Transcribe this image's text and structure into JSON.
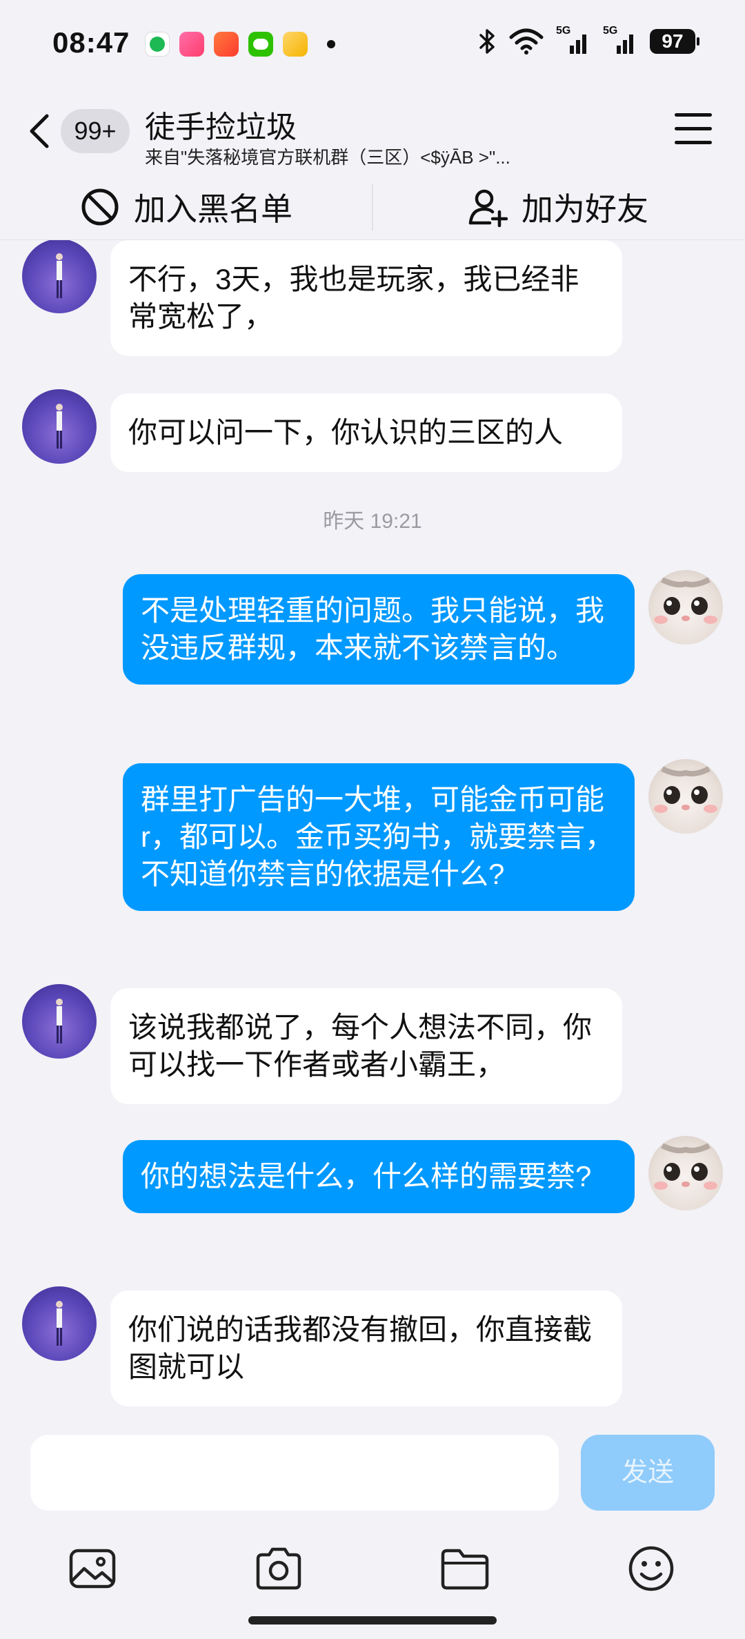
{
  "status_bar": {
    "time": "08:47",
    "battery": "97",
    "signal_label_1": "5G",
    "signal_label_2": "5G"
  },
  "header": {
    "unread_count": "99+",
    "title": "徒手捡垃圾",
    "subtitle": "来自\"失落秘境官方联机群（三区）<$ÿĀB >\"..."
  },
  "actions": {
    "blacklist": "加入黑名单",
    "add_friend": "加为好友"
  },
  "messages": [
    {
      "side": "left",
      "text": "不行，3天，我也是玩家，我已经非常宽松了，"
    },
    {
      "side": "left",
      "text": "你可以问一下，你认识的三区的人"
    },
    {
      "side": "time",
      "text": "昨天 19:21"
    },
    {
      "side": "right",
      "text": "不是处理轻重的问题。我只能说，我没违反群规，本来就不该禁言的。"
    },
    {
      "side": "right",
      "text": "群里打广告的一大堆，可能金币可能r，都可以。金币买狗书，就要禁言，不知道你禁言的依据是什么?"
    },
    {
      "side": "left",
      "text": "该说我都说了，每个人想法不同，你可以找一下作者或者小霸王，"
    },
    {
      "side": "right",
      "text": "你的想法是什么，什么样的需要禁?"
    },
    {
      "side": "left",
      "text": "你们说的话我都没有撤回，你直接截图就可以"
    }
  ],
  "input": {
    "value": "",
    "placeholder": "",
    "send_label": "发送"
  },
  "colors": {
    "accent": "#0099ff",
    "send_disabled": "#8fcbfb",
    "background": "#f2f2f7"
  }
}
